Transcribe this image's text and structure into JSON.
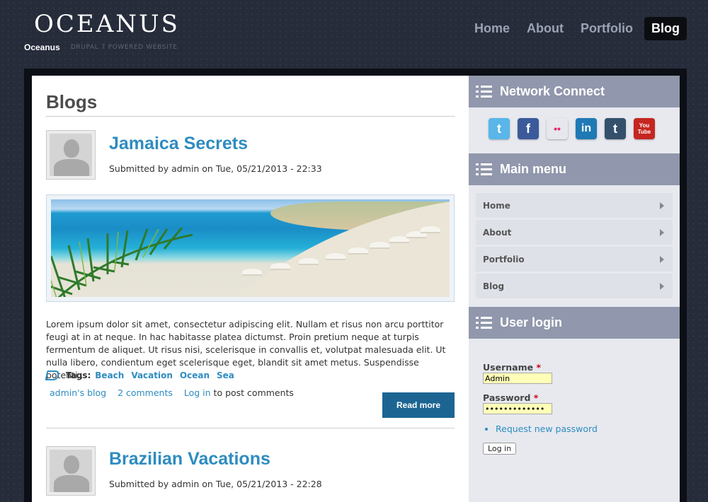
{
  "header": {
    "logo": "OCEANUS",
    "site_name": "Oceanus",
    "slogan": "DRUPAL 7 POWERED WEBSITE",
    "nav": [
      {
        "label": "Home"
      },
      {
        "label": "About"
      },
      {
        "label": "Portfolio"
      },
      {
        "label": "Blog",
        "active": true
      }
    ]
  },
  "content": {
    "page_title": "Blogs",
    "posts": [
      {
        "title": "Jamaica Secrets",
        "submitted": "Submitted by admin on Tue, 05/21/2013 - 22:33",
        "teaser": "Lorem ipsum dolor sit amet, consectetur adipiscing elit. Nullam et risus non arcu porttitor feugi at in at neque. In hac habitasse platea dictumst. Proin pretium neque at turpis fermentum de aliquet. Ut risus nisi, scelerisque in convallis et, volutpat malesuada elit. Ut nulla libero, condientum eget scelerisque eget, blandit sit amet metus. Suspendisse potenti...",
        "tags_label": "Tags:",
        "tags": [
          "Beach",
          "Vacation",
          "Ocean",
          "Sea"
        ],
        "links": {
          "blog": "admin's blog",
          "comments": "2 comments",
          "login": "Log in",
          "login_suffix": " to post comments"
        },
        "read_more": "Read more"
      },
      {
        "title": "Brazilian Vacations",
        "submitted": "Submitted by admin on Tue, 05/21/2013 - 22:28"
      }
    ]
  },
  "sidebar": {
    "network": {
      "title": "Network Connect",
      "icons": [
        {
          "name": "twitter-icon",
          "glyph": "t",
          "color": "#59b6e8"
        },
        {
          "name": "facebook-icon",
          "glyph": "f",
          "color": "#3b5a9a"
        },
        {
          "name": "flickr-icon",
          "glyph": "••",
          "color": "#e7e7ee"
        },
        {
          "name": "linkedin-icon",
          "glyph": "in",
          "color": "#1f79b4"
        },
        {
          "name": "tumblr-icon",
          "glyph": "t",
          "color": "#34506b"
        },
        {
          "name": "youtube-icon",
          "glyph": "You Tube",
          "color": "#c6261f"
        }
      ]
    },
    "main_menu": {
      "title": "Main menu",
      "items": [
        {
          "label": "Home"
        },
        {
          "label": "About"
        },
        {
          "label": "Portfolio"
        },
        {
          "label": "Blog"
        }
      ]
    },
    "login": {
      "title": "User login",
      "username_label": "Username",
      "username_value": "Admin",
      "password_label": "Password",
      "password_value": "•••••••••••••",
      "required_mark": "*",
      "request_password": "Request new password",
      "submit": "Log in"
    }
  },
  "colors": {
    "accent": "#2e8cc0",
    "read_more_bg": "#1c6592",
    "block_header": "#9197ac",
    "page_bg": "#262c3a"
  }
}
